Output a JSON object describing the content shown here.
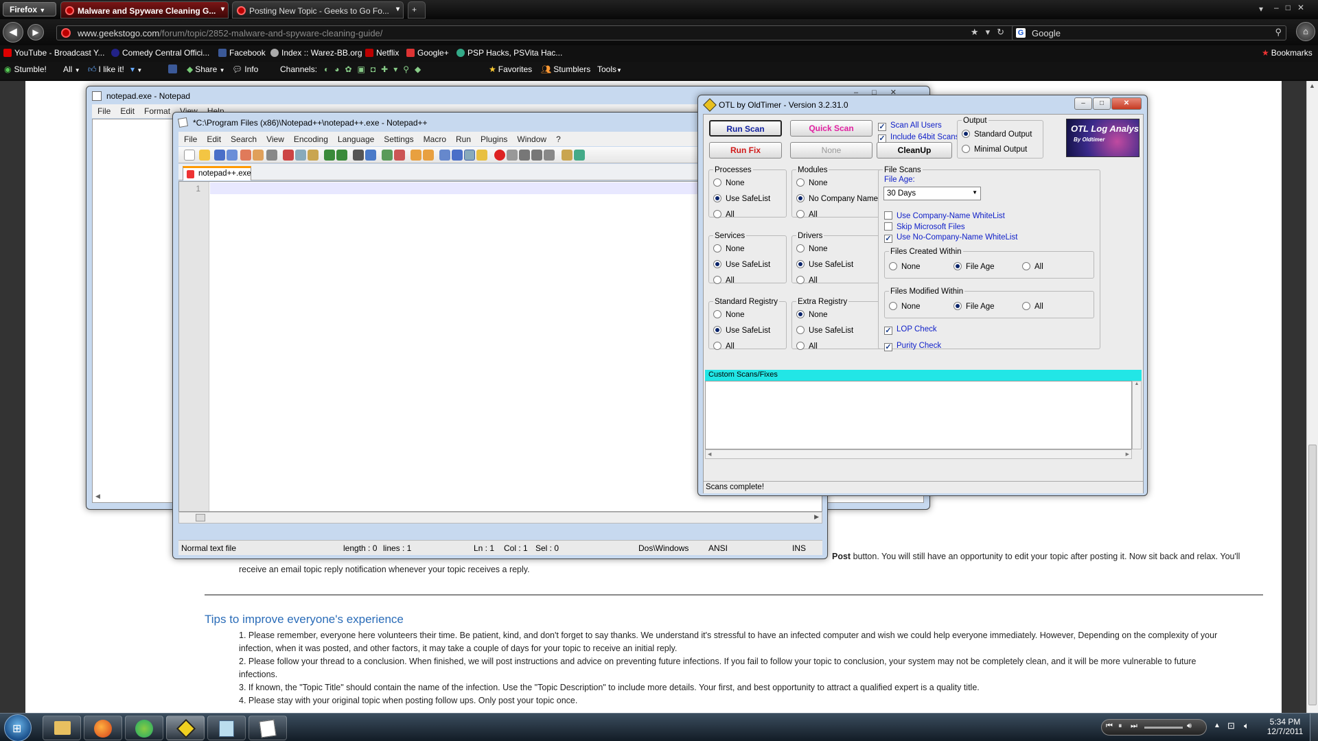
{
  "firefox": {
    "menu_label": "Firefox",
    "tabs": [
      {
        "title": "Malware and Spyware Cleaning G..."
      },
      {
        "title": "Posting New Topic - Geeks to Go Fo..."
      }
    ],
    "url_host": "www.geekstogo.com",
    "url_path": "/forum/topic/2852-malware-and-spyware-cleaning-guide/",
    "search_engine": "Google",
    "bookmarks": [
      "YouTube - Broadcast Y...",
      "Comedy Central Offici...",
      "Facebook",
      "Index :: Warez-BB.org",
      "Netflix",
      "Google+",
      "PSP Hacks, PSVita Hac..."
    ],
    "bookmarks_menu": "Bookmarks",
    "toolbar": {
      "stumble": "Stumble!",
      "all": "All",
      "like": "I like it!",
      "share": "Share",
      "info": "Info",
      "channels": "Channels:",
      "favorites": "Favorites",
      "stumblers": "Stumblers",
      "tools": "Tools"
    }
  },
  "page": {
    "post_btn_text": "Post",
    "para_line1": "button. You will still have an opportunity to edit your topic after posting it. Now sit back and relax. You'll",
    "para_line2": "receive an email topic reply notification whenever your topic receives a reply.",
    "tips_heading": "Tips to improve everyone's experience",
    "tips": [
      "1. Please remember, everyone here volunteers their time. Be patient, kind, and don't forget to say thanks. We understand it's stressful to have an infected computer and wish we could help everyone immediately. However, Depending on the complexity of your",
      "infection, when it was posted, and other factors, it may take a couple of days for your topic to receive an initial reply.",
      "2. Please follow your thread to a conclusion. When finished, we will post instructions and advice on preventing future infections. If you fail to follow your topic to conclusion, your system may not be completely clean, and it will be more vulnerable to future",
      "infections.",
      "3. If known, the \"Topic Title\" should contain the name of the infection. Use the \"Topic Description\" to include more details. Your first, and best opportunity to attract a qualified expert is a quality title.",
      "4. Please stay with your original topic when posting follow ups. Only post your topic once."
    ]
  },
  "notepad": {
    "title": "notepad.exe - Notepad",
    "menu": [
      "File",
      "Edit",
      "Format",
      "View",
      "Help"
    ]
  },
  "notepadpp": {
    "title": "*C:\\Program Files (x86)\\Notepad++\\notepad++.exe - Notepad++",
    "menu": [
      "File",
      "Edit",
      "Search",
      "View",
      "Encoding",
      "Language",
      "Settings",
      "Macro",
      "Run",
      "Plugins",
      "Window",
      "?"
    ],
    "tab": "notepad++.exe",
    "line_number": "1",
    "status": {
      "filetype": "Normal text file",
      "length": "length : 0",
      "lines": "lines : 1",
      "ln": "Ln : 1",
      "col": "Col : 1",
      "sel": "Sel : 0",
      "eol": "Dos\\Windows",
      "encoding": "ANSI",
      "mode": "INS"
    }
  },
  "otl": {
    "title": "OTL by OldTimer - Version 3.2.31.0",
    "buttons": {
      "run_scan": "Run Scan",
      "quick_scan": "Quick Scan",
      "run_fix": "Run Fix",
      "none": "None",
      "cleanup": "CleanUp"
    },
    "scan_all_users": "Scan All Users",
    "include_64bit": "Include 64bit Scans",
    "output": {
      "label": "Output",
      "standard": "Standard Output",
      "minimal": "Minimal Output"
    },
    "logo_text": "OTL Log Analysis",
    "logo_sub": "By Oldtimer",
    "groups": {
      "processes": {
        "label": "Processes",
        "options": [
          "None",
          "Use SafeList",
          "All"
        ],
        "selected": 1
      },
      "modules": {
        "label": "Modules",
        "options": [
          "None",
          "No Company Name",
          "All"
        ],
        "selected": 1
      },
      "services": {
        "label": "Services",
        "options": [
          "None",
          "Use SafeList",
          "All"
        ],
        "selected": 1
      },
      "drivers": {
        "label": "Drivers",
        "options": [
          "None",
          "Use SafeList",
          "All"
        ],
        "selected": 1
      },
      "std_registry": {
        "label": "Standard Registry",
        "options": [
          "None",
          "Use SafeList",
          "All"
        ],
        "selected": 1
      },
      "ext_registry": {
        "label": "Extra Registry",
        "options": [
          "None",
          "Use SafeList",
          "All"
        ],
        "selected": 0
      }
    },
    "file_scans": {
      "label": "File Scans",
      "file_age_label": "File Age:",
      "file_age_value": "30 Days",
      "checks": [
        {
          "label": "Use Company-Name WhiteList",
          "checked": false
        },
        {
          "label": "Skip Microsoft Files",
          "checked": false
        },
        {
          "label": "Use No-Company-Name WhiteList",
          "checked": true
        }
      ],
      "created_within": {
        "label": "Files Created Within",
        "options": [
          "None",
          "File Age",
          "All"
        ],
        "selected": 1
      },
      "modified_within": {
        "label": "Files Modified Within",
        "options": [
          "None",
          "File Age",
          "All"
        ],
        "selected": 1
      },
      "lop_check": "LOP Check",
      "purity_check": "Purity Check"
    },
    "custom_label": "Custom Scans/Fixes",
    "status": "Scans complete!"
  },
  "taskbar": {
    "time": "5:34 PM",
    "date": "12/7/2011"
  }
}
